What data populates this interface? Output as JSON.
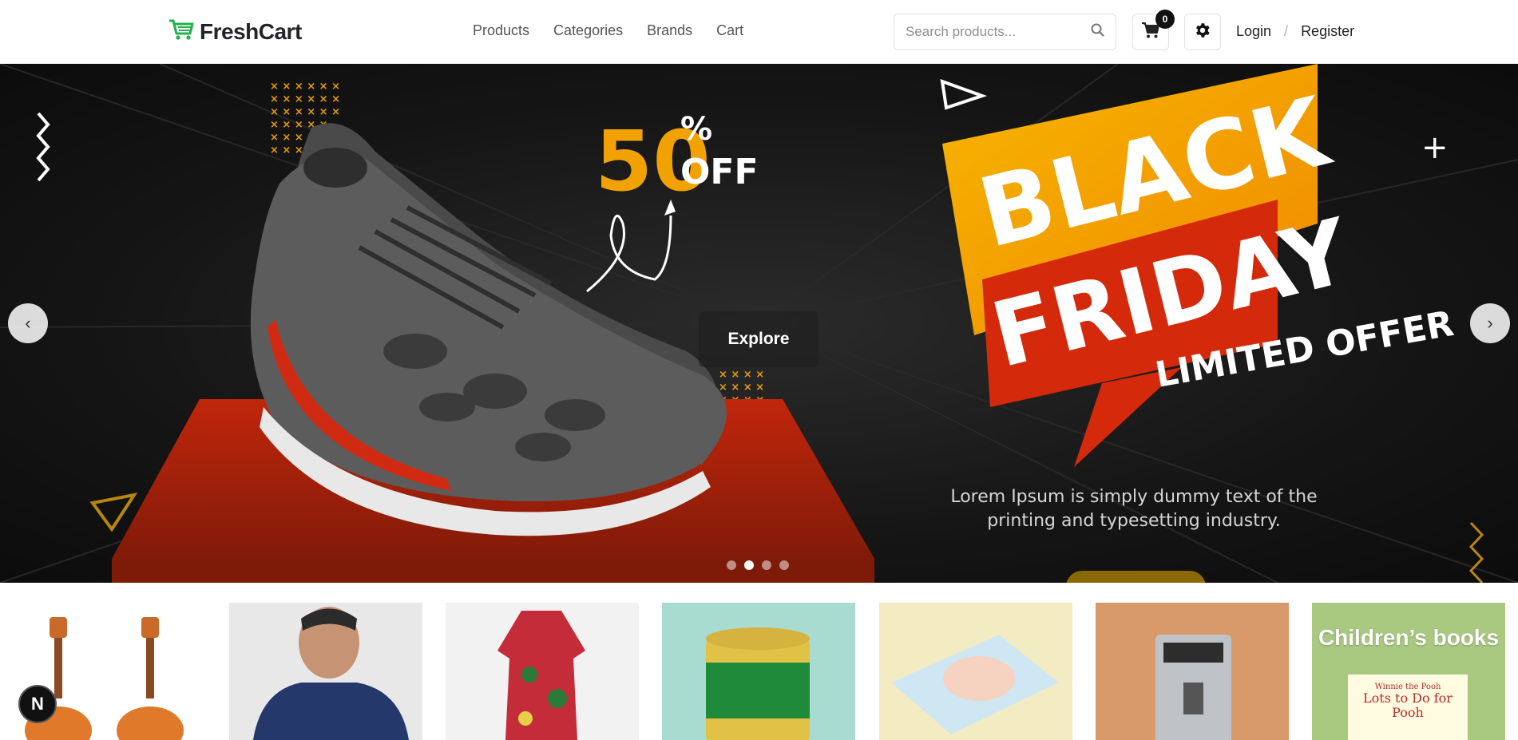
{
  "brand": {
    "name": "FreshCart",
    "logo_icon": "cart-icon",
    "color": "#22b14c"
  },
  "nav": {
    "links": [
      "Products",
      "Categories",
      "Brands",
      "Cart"
    ]
  },
  "search": {
    "placeholder": "Search products..."
  },
  "cart": {
    "count": "0"
  },
  "auth": {
    "login": "Login",
    "separator": "/",
    "register": "Register"
  },
  "hero": {
    "discount_number": "50",
    "discount_percent": "%",
    "discount_off": "OFF",
    "banner_line1": "BLACK",
    "banner_line2": "FRIDAY",
    "banner_line3": "LIMITED OFFER",
    "explore_label": "Explore",
    "description": "Lorem Ipsum is simply dummy text of the printing and typesetting industry.",
    "prev_label": "‹",
    "next_label": "›",
    "slide_count": 4,
    "active_slide": 2,
    "colors": {
      "accent_orange": "#f5a300",
      "accent_red": "#d42a0b",
      "background": "#151515"
    }
  },
  "categories": [
    {
      "name": "guitars",
      "bg": "#ffffff"
    },
    {
      "name": "mens-hoodie",
      "bg": "#e8e8e8"
    },
    {
      "name": "floral-dress",
      "bg": "#f2f2f2"
    },
    {
      "name": "baby-milk",
      "bg": "#a9dcd0"
    },
    {
      "name": "diapers",
      "bg": "#f3ecc2"
    },
    {
      "name": "coffee-machine",
      "bg": "#d89a6a"
    },
    {
      "name": "children-books",
      "bg": "#a9c981",
      "label": "Children’s books",
      "book_title": "Lots to Do for Pooh",
      "book_brand": "Winnie the Pooh"
    }
  ],
  "fab": {
    "label": "N"
  }
}
